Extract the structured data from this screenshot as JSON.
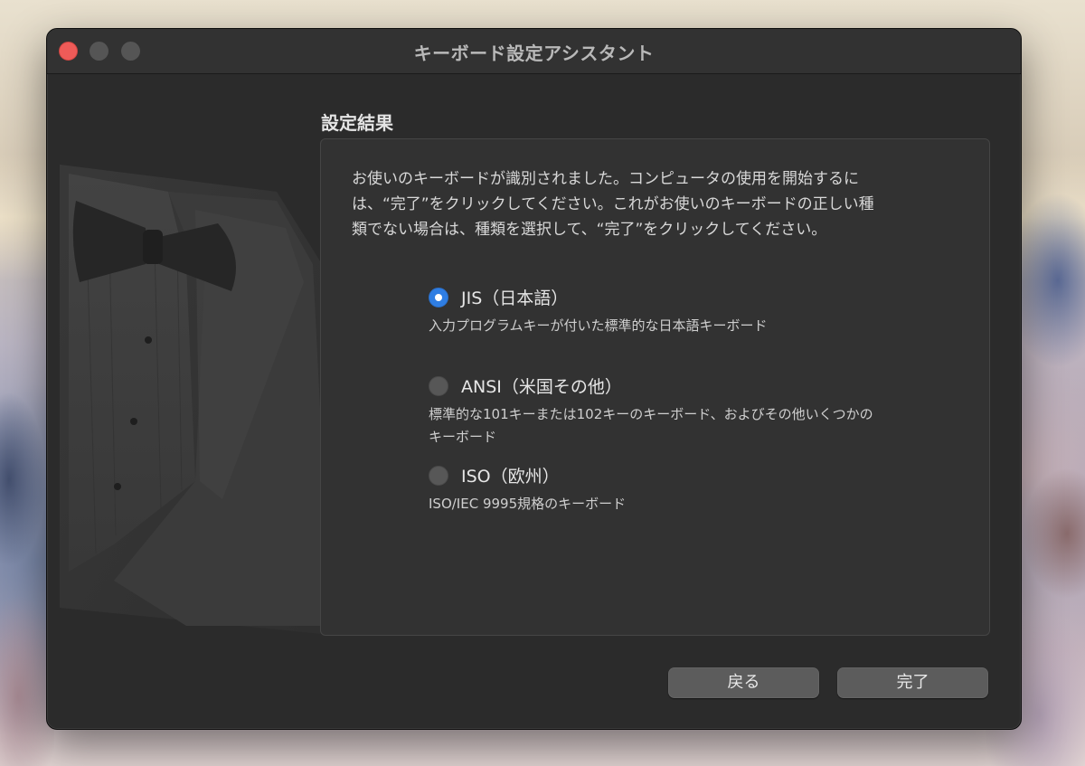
{
  "window": {
    "title": "キーボード設定アシスタント"
  },
  "main": {
    "section_title": "設定結果",
    "description_lines": [
      "お使いのキーボードが識別されました。コンピュータの使用を開始するに",
      "は、“完了”をクリックしてください。これがお使いのキーボードの正しい種",
      "類でない場合は、種類を選択して、“完了”をクリックしてください。"
    ],
    "options": [
      {
        "label": "JIS（日本語）",
        "description_lines": [
          "入力プログラムキーが付いた標準的な日本語キーボード"
        ],
        "selected": true
      },
      {
        "label": "ANSI（米国その他）",
        "description_lines": [
          "標準的な101キーまたは102キーのキーボード、およびその他いくつかの",
          "キーボード"
        ],
        "selected": false
      },
      {
        "label": "ISO（欧州）",
        "description_lines": [
          "ISO/IEC 9995規格のキーボード"
        ],
        "selected": false
      }
    ]
  },
  "footer": {
    "back_label": "戻る",
    "done_label": "完了"
  },
  "colors": {
    "accent": "#2f7ee3",
    "window_bg": "#2b2b2b",
    "panel_bg": "#323232",
    "close_button": "#ee5b58"
  }
}
